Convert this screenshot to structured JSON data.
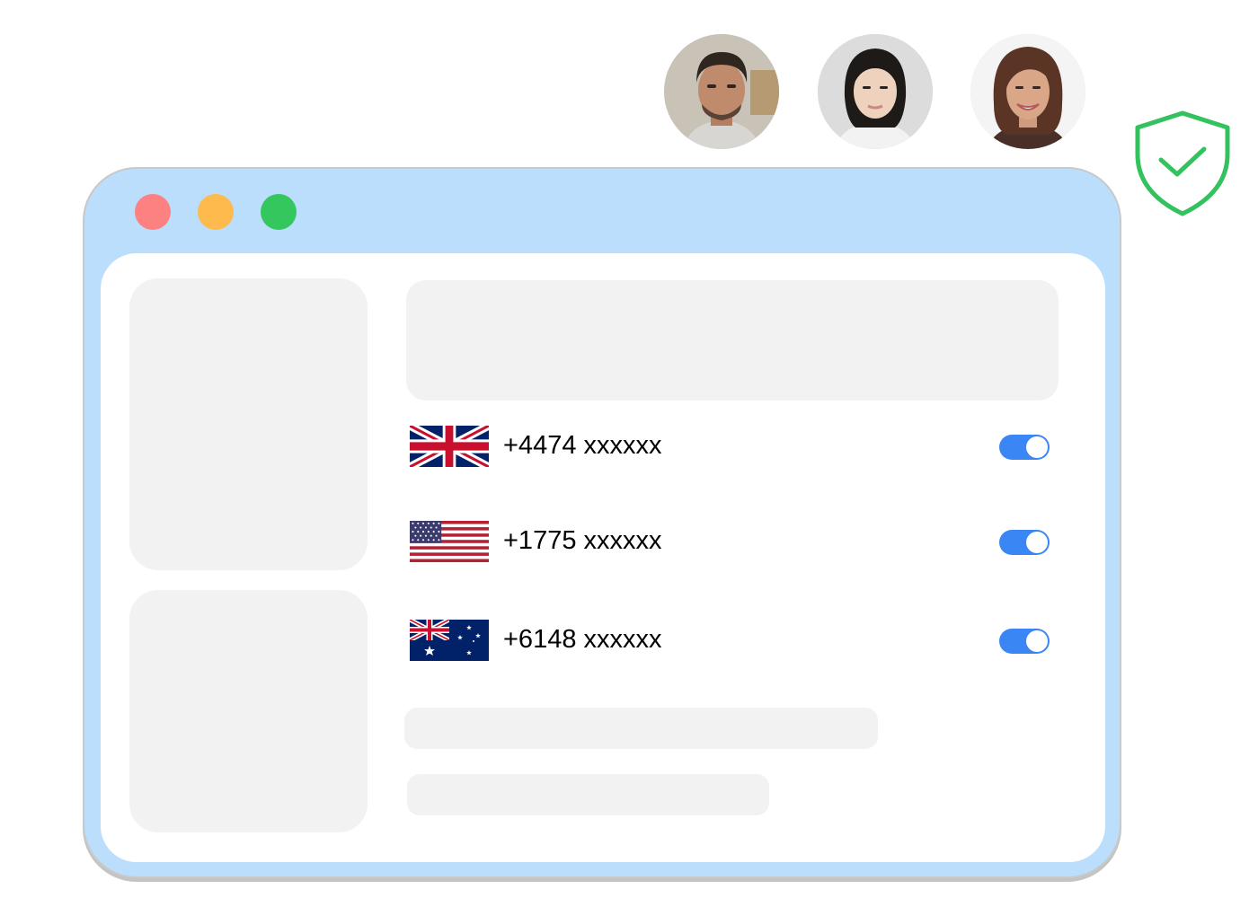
{
  "avatars": [
    {
      "icon": "male-avatar-icon"
    },
    {
      "icon": "female-avatar-icon"
    },
    {
      "icon": "female-avatar-icon"
    }
  ],
  "security": {
    "icon": "shield-check-icon",
    "color": "#34c25f"
  },
  "window": {
    "frame_color": "#badefb",
    "controls": {
      "close": "#fe8181",
      "minimize": "#ffba4d",
      "maximize": "#33c75e"
    }
  },
  "phones": [
    {
      "country_flag": "uk-flag-icon",
      "number": "+4474 xxxxxx",
      "enabled": true
    },
    {
      "country_flag": "us-flag-icon",
      "number": "+1775 xxxxxx",
      "enabled": true
    },
    {
      "country_flag": "au-flag-icon",
      "number": "+6148 xxxxxx",
      "enabled": true
    }
  ],
  "toggle_color": "#3a86f4"
}
